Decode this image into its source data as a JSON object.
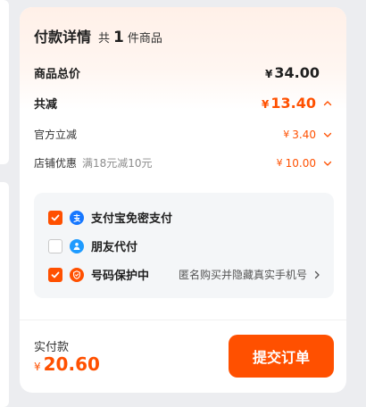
{
  "header": {
    "title": "付款详情",
    "count_prefix": "共",
    "count_value": "1",
    "count_suffix": "件商品"
  },
  "total": {
    "label": "商品总价",
    "currency": "¥",
    "amount": "34.00"
  },
  "reduction": {
    "label": "共减",
    "currency": "¥",
    "amount": "13.40"
  },
  "discounts": [
    {
      "label": "官方立减",
      "note": "",
      "currency": "¥",
      "amount": "3.40"
    },
    {
      "label": "店铺优惠",
      "note": "满18元减10元",
      "currency": "¥",
      "amount": "10.00"
    }
  ],
  "options": [
    {
      "label": "支付宝免密支付",
      "checked": true,
      "icon": "alipay-icon",
      "icon_color": "#1677ff"
    },
    {
      "label": "朋友代付",
      "checked": false,
      "icon": "friend-pay-icon",
      "icon_color": "#1e9bff"
    },
    {
      "label": "号码保护中",
      "checked": true,
      "icon": "shield-icon",
      "icon_color": "#ff5000",
      "extra": "匿名购买并隐藏真实手机号"
    }
  ],
  "footer": {
    "pay_label": "实付款",
    "currency": "¥",
    "pay_amount": "20.60",
    "submit_label": "提交订单"
  },
  "colors": {
    "accent": "#ff5000",
    "background": "#ecedf0"
  }
}
